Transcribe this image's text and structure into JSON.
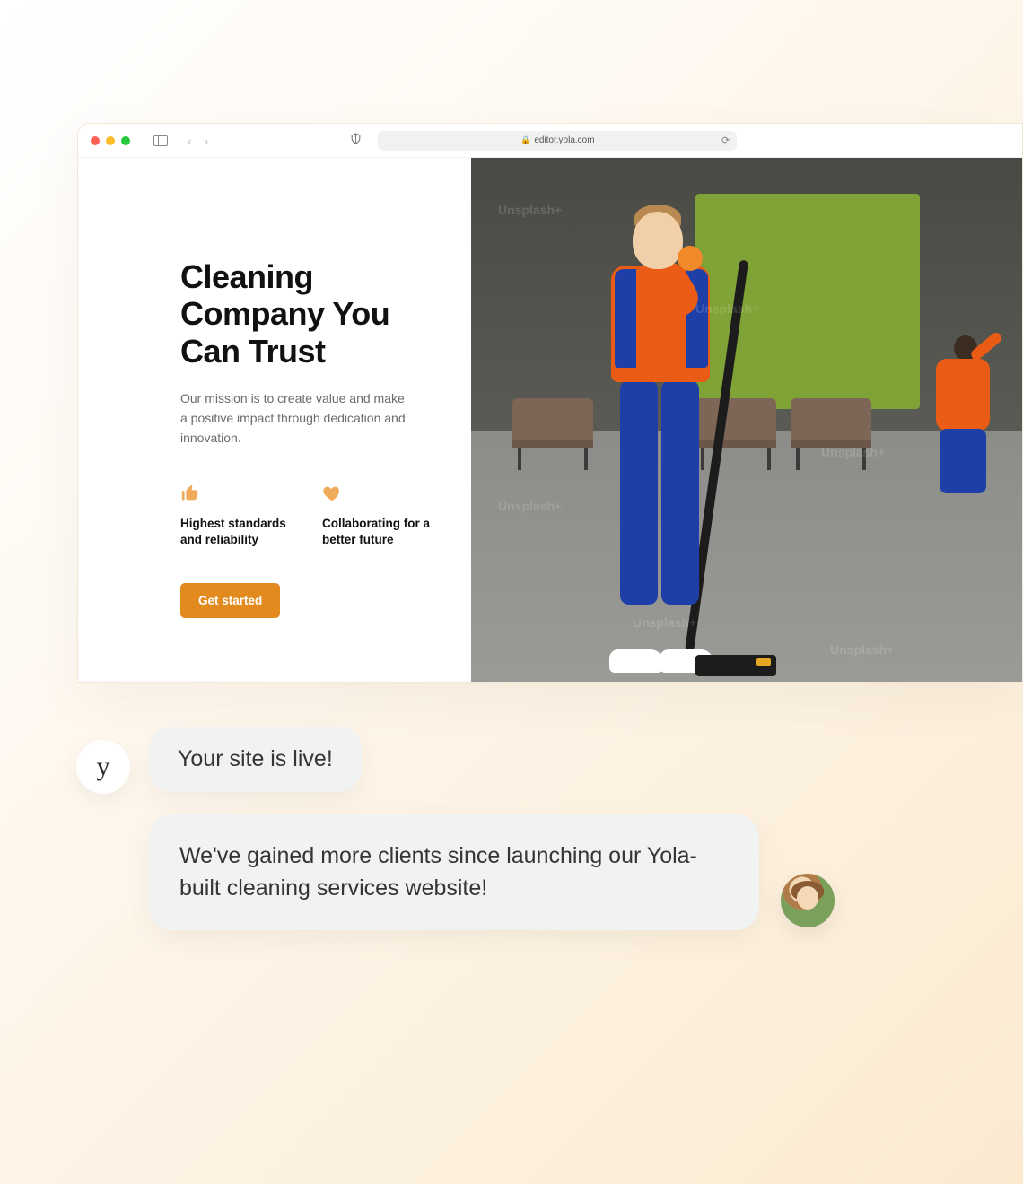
{
  "browser": {
    "url": "editor.yola.com"
  },
  "hero": {
    "title_line1": "Cleaning",
    "title_line2": "Company You",
    "title_line3": "Can Trust",
    "subtitle": "Our mission is to create value and make a positive impact through dedication and innovation.",
    "cta": "Get started"
  },
  "features": [
    {
      "label": "Highest standards and reliability"
    },
    {
      "label": "Collaborating for a better future"
    }
  ],
  "image_watermark": "Unsplash+",
  "chat": {
    "agent_avatar_letter": "y",
    "bubble1": "Your site is live!",
    "bubble2": "We've gained more clients since launching our Yola-built cleaning services website!"
  },
  "colors": {
    "accent": "#e38a1f",
    "feature_icon": "#f1a95a"
  }
}
